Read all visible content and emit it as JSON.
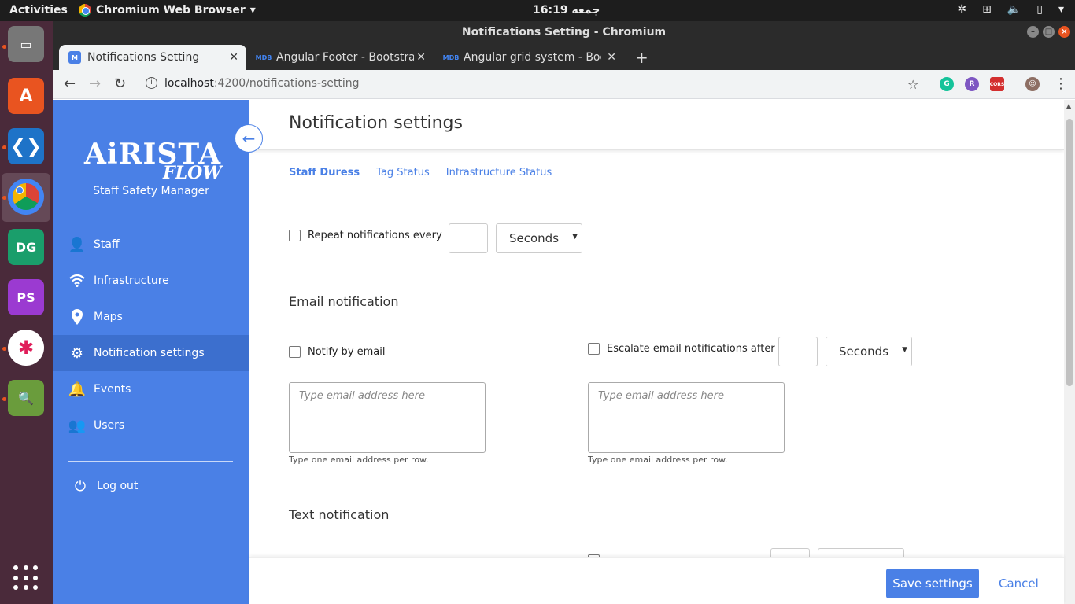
{
  "system": {
    "activities": "Activities",
    "app_menu": "Chromium Web Browser",
    "clock": "16:19 جمعه"
  },
  "window": {
    "title": "Notifications Setting - Chromium"
  },
  "tabs": [
    {
      "label": "Notifications Setting",
      "favicon": "M"
    },
    {
      "label": "Angular Footer - Bootstrap",
      "favicon": "MDB"
    },
    {
      "label": "Angular grid system - Bootstrap",
      "favicon": "MDB"
    }
  ],
  "address": {
    "host": "localhost",
    "path": ":4200/notifications-setting"
  },
  "brand": {
    "logo_main": "AiRISTA",
    "logo_sub": "FLOW",
    "tagline": "Staff Safety Manager"
  },
  "sidebar": {
    "items": [
      {
        "label": "Staff",
        "icon": "person-icon"
      },
      {
        "label": "Infrastructure",
        "icon": "wifi-icon"
      },
      {
        "label": "Maps",
        "icon": "map-pin-icon"
      },
      {
        "label": "Notification settings",
        "icon": "gear-icon"
      },
      {
        "label": "Events",
        "icon": "bell-icon"
      },
      {
        "label": "Users",
        "icon": "users-icon"
      }
    ],
    "logout": "Log out"
  },
  "page": {
    "title": "Notification settings",
    "subtabs": [
      "Staff Duress",
      "Tag Status",
      "Infrastructure Status"
    ],
    "repeat_label": "Repeat notifications every",
    "repeat_unit": "Seconds",
    "email_section": "Email notification",
    "notify_email_label": "Notify by email",
    "escalate_email_label": "Escalate email notifications after",
    "escalate_unit": "Seconds",
    "email_placeholder": "Type email address here",
    "email_help": "Type one email address per row.",
    "text_section": "Text notification"
  },
  "footer": {
    "save": "Save settings",
    "cancel": "Cancel"
  },
  "colors": {
    "primary": "#4a80e6",
    "sidebar_active": "#3c6fce"
  }
}
